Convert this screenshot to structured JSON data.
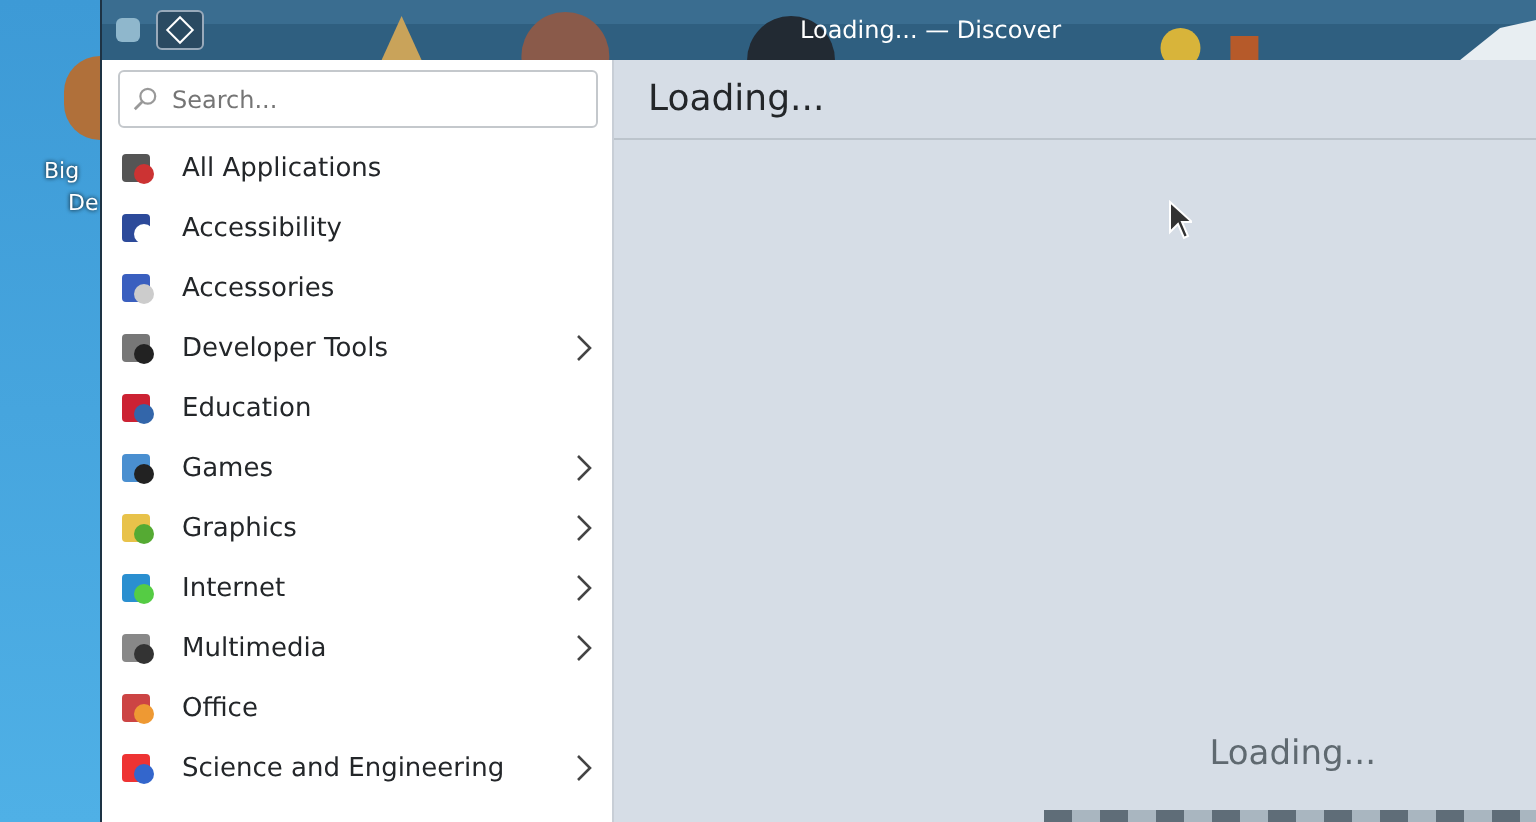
{
  "desktop": {
    "icon_label_lines": [
      "Big",
      "De"
    ]
  },
  "window": {
    "title": "Loading... — Discover"
  },
  "search": {
    "placeholder": "Search..."
  },
  "categories": [
    {
      "label": "All Applications",
      "has_submenu": false
    },
    {
      "label": "Accessibility",
      "has_submenu": false
    },
    {
      "label": "Accessories",
      "has_submenu": false
    },
    {
      "label": "Developer Tools",
      "has_submenu": true
    },
    {
      "label": "Education",
      "has_submenu": false
    },
    {
      "label": "Games",
      "has_submenu": true
    },
    {
      "label": "Graphics",
      "has_submenu": true
    },
    {
      "label": "Internet",
      "has_submenu": true
    },
    {
      "label": "Multimedia",
      "has_submenu": true
    },
    {
      "label": "Office",
      "has_submenu": false
    },
    {
      "label": "Science and Engineering",
      "has_submenu": true
    }
  ],
  "page": {
    "heading": "Loading...",
    "status": "Loading..."
  }
}
